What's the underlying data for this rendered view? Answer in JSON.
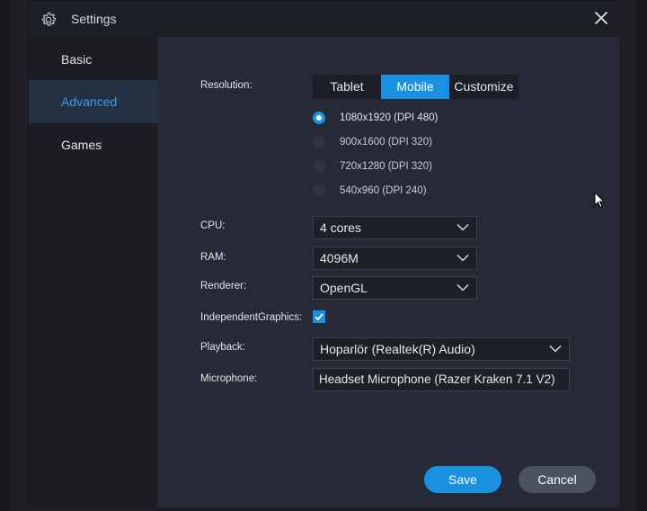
{
  "window": {
    "title": "Settings"
  },
  "sidebar": {
    "items": [
      {
        "label": "Basic",
        "active": false
      },
      {
        "label": "Advanced",
        "active": true
      },
      {
        "label": "Games",
        "active": false
      }
    ]
  },
  "resolution": {
    "label": "Resolution:",
    "modes": [
      "Tablet",
      "Mobile",
      "Customize"
    ],
    "selected_mode": "Mobile",
    "options": [
      "1080x1920 (DPI 480)",
      "900x1600 (DPI 320)",
      "720x1280 (DPI 320)",
      "540x960 (DPI 240)"
    ],
    "selected_option": "1080x1920 (DPI 480)"
  },
  "cpu": {
    "label": "CPU:",
    "value": "4 cores"
  },
  "ram": {
    "label": "RAM:",
    "value": "4096M"
  },
  "renderer": {
    "label": "Renderer:",
    "value": "OpenGL"
  },
  "independent_graphics": {
    "label": "IndependentGraphics:",
    "checked": true
  },
  "playback": {
    "label": "Playback:",
    "value": "Hoparlör (Realtek(R) Audio)"
  },
  "microphone": {
    "label": "Microphone:",
    "value": "Headset Microphone (Razer Kraken 7.1 V2)"
  },
  "buttons": {
    "save": "Save",
    "cancel": "Cancel"
  },
  "colors": {
    "accent": "#1a90e0",
    "dialog_bg": "#252a36",
    "sidebar_bg": "#1b1d23",
    "cancel_bg": "#4a5160"
  },
  "icons": [
    "gear-icon",
    "close-icon",
    "chevron-down-icon",
    "checkmark-icon",
    "mouse-cursor"
  ]
}
